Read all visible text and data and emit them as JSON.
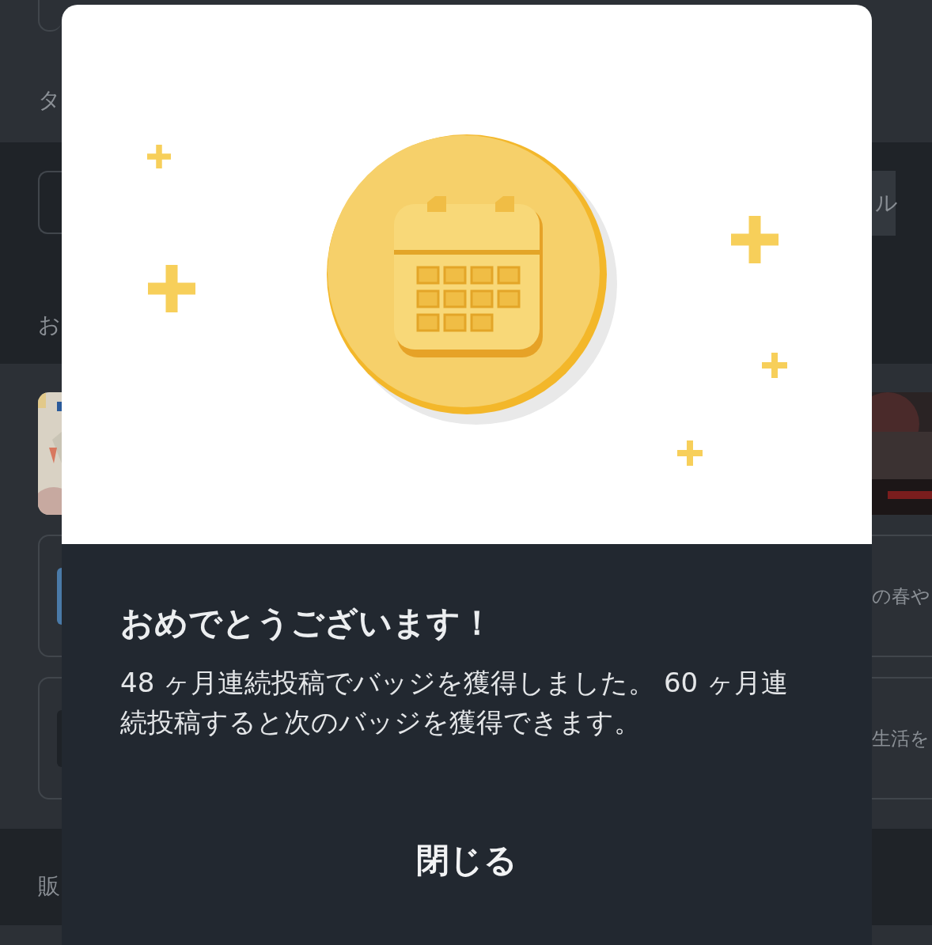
{
  "background": {
    "top_label": "タ",
    "side_button": "ル",
    "section_heading": "お",
    "cards": [
      {
        "kind": "picture"
      },
      {
        "kind": "article",
        "snippet": "の春や"
      },
      {
        "kind": "article",
        "snippet": "生活を"
      }
    ],
    "footer_heading": "販"
  },
  "modal": {
    "title": "おめでとうございます！",
    "message": "48 ヶ月連続投稿でバッジを獲得しました。 60 ヶ月連続投稿すると次のバッジを獲得できます。",
    "close_button": "閉じる"
  }
}
